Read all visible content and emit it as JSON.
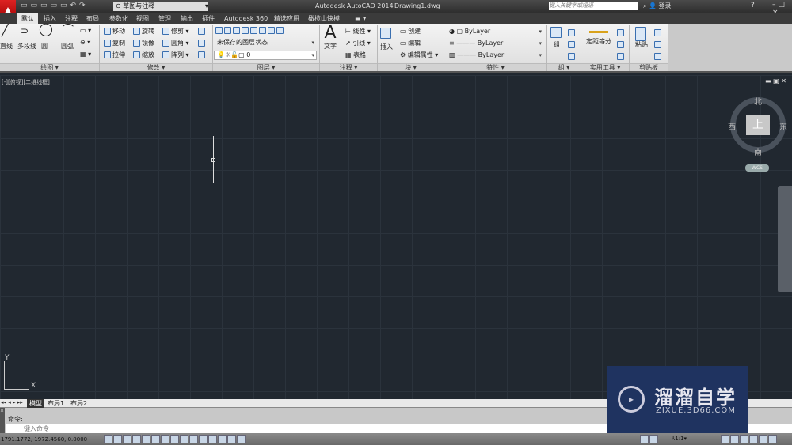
{
  "titlebar": {
    "workspace": "草图与注释",
    "app_title": "Autodesk AutoCAD 2014",
    "file": "Drawing1.dwg",
    "search_placeholder": "键入关键字或短语",
    "login": "登录"
  },
  "tabs": [
    "默认",
    "插入",
    "注释",
    "布局",
    "参数化",
    "视图",
    "管理",
    "输出",
    "插件",
    "Autodesk 360",
    "精选应用",
    "橄榄山快模"
  ],
  "active_tab": "默认",
  "ribbon": {
    "draw": {
      "label": "绘图 ▾",
      "items": [
        "直线",
        "多段线",
        "圆",
        "圆弧"
      ]
    },
    "modify": {
      "label": "修改 ▾",
      "items": [
        "移动",
        "旋转",
        "修剪",
        "复制",
        "镜像",
        "圆角",
        "拉伸",
        "缩放",
        "阵列"
      ]
    },
    "layers": {
      "label": "图层 ▾",
      "state": "未保存的图层状态",
      "current": "0"
    },
    "annotation": {
      "label": "注释 ▾",
      "text": "文字",
      "items": [
        "线性",
        "引线",
        "表格"
      ]
    },
    "block": {
      "label": "块 ▾",
      "insert": "插入",
      "items": [
        "创建",
        "编辑",
        "编辑属性"
      ]
    },
    "properties": {
      "label": "特性 ▾",
      "color": "ByLayer",
      "linetype": "ByLayer",
      "lineweight": "ByLayer"
    },
    "groups": {
      "label": "组 ▾",
      "group": "组"
    },
    "utilities": {
      "label": "实用工具 ▾",
      "measure": "定距等分"
    },
    "clipboard": {
      "label": "剪贴板",
      "paste": "粘贴"
    }
  },
  "viewport": {
    "label": "[-][俯视][二维线框]"
  },
  "viewcube": {
    "north": "北",
    "south": "南",
    "east": "东",
    "west": "西",
    "top": "上",
    "wcs": "WCS"
  },
  "ucs": {
    "y": "Y",
    "x": "X"
  },
  "layout_tabs": [
    "模型",
    "布局1",
    "布局2"
  ],
  "command": {
    "history": "命令:",
    "placeholder": "键入命令"
  },
  "status": {
    "coords": "1791.1772, 1972.4560, 0.0000",
    "scale": "1:1"
  },
  "watermark": {
    "name": "溜溜自学",
    "url": "ZIXUE.3D66.COM"
  },
  "colors": {
    "canvas": "#212830",
    "accent": "#c00000",
    "watermark": "#1f3360"
  }
}
